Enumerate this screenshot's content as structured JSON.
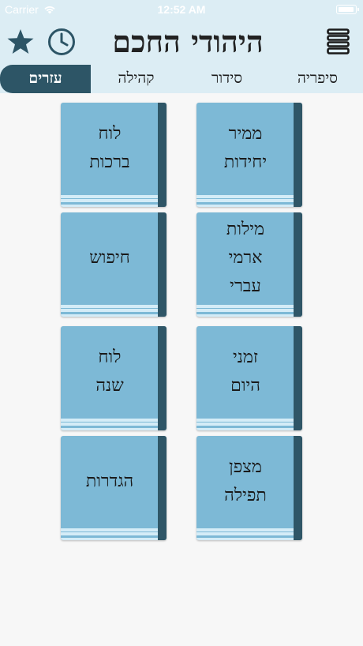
{
  "status_bar": {
    "carrier": "Carrier",
    "time": "12:52 AM"
  },
  "header": {
    "title": "היהודי החכם"
  },
  "tabs": [
    {
      "label": "סיפריה"
    },
    {
      "label": "סידור"
    },
    {
      "label": "קהילה"
    },
    {
      "label": "עזרים",
      "active": true
    }
  ],
  "books": [
    {
      "label": "ממיר\nיחידות"
    },
    {
      "label": "לוח\nברכות"
    },
    {
      "label": "מילות\nארמי\nעברי"
    },
    {
      "label": "חיפוש"
    },
    {
      "label": "זמני\nהיום"
    },
    {
      "label": "לוח\nשנה"
    },
    {
      "label": "מצפן\nתפילה"
    },
    {
      "label": "הגדרות"
    }
  ],
  "colors": {
    "header_bg": "#dcedf4",
    "active_tab_bg": "#2d5566",
    "book_cover": "#7db9d6",
    "book_spine": "#2f5667",
    "book_pages": "#d4ecf7",
    "icon_color": "#2d5566"
  },
  "icons": {
    "favorites": "star-icon",
    "history": "clock-icon",
    "menu": "books-stack-icon",
    "wifi": "wifi-icon",
    "battery": "battery-icon"
  }
}
